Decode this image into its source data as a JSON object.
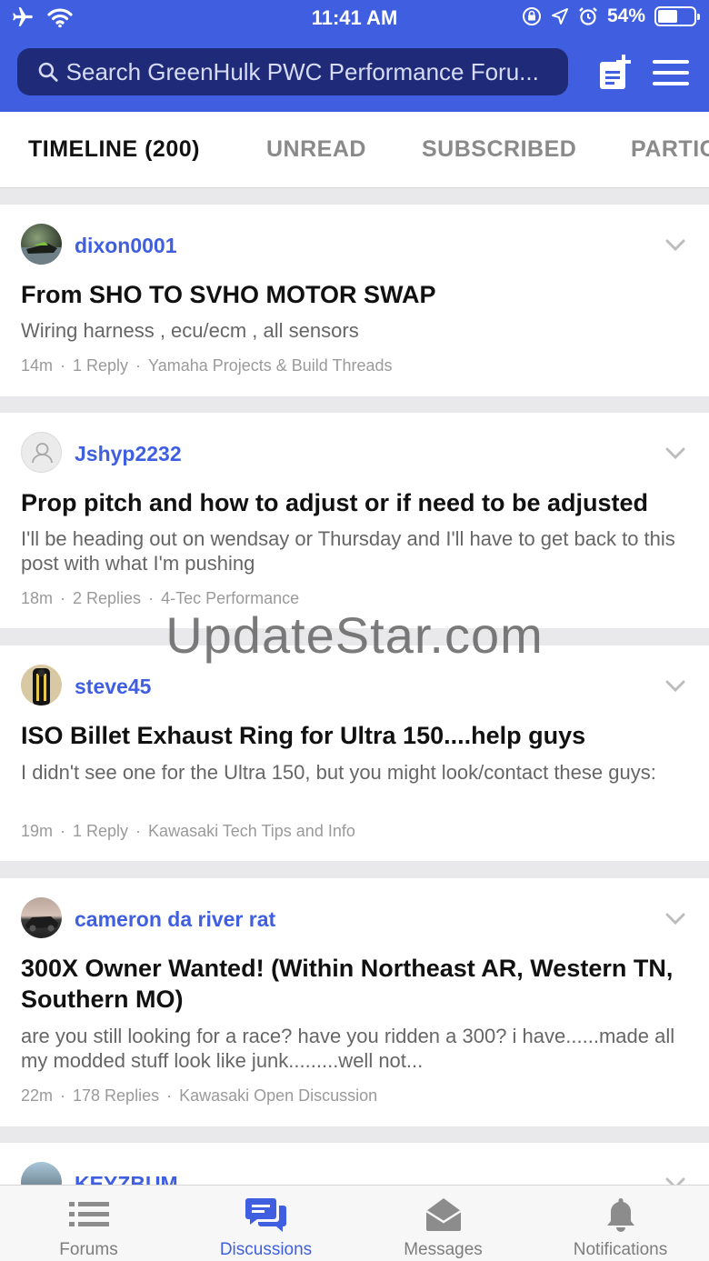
{
  "status_bar": {
    "time": "11:41 AM",
    "battery": "54%",
    "battery_level": 0.54
  },
  "search": {
    "placeholder": "Search GreenHulk PWC Performance Foru..."
  },
  "tabs": [
    {
      "label": "TIMELINE (200)",
      "active": true
    },
    {
      "label": "UNREAD",
      "active": false
    },
    {
      "label": "SUBSCRIBED",
      "active": false
    },
    {
      "label": "PARTICIPATED",
      "active": false
    }
  ],
  "posts": [
    {
      "username": "dixon0001",
      "title": "From SHO TO SVHO MOTOR SWAP",
      "snippet": "Wiring harness , ecu/ecm , all sensors",
      "time": "14m",
      "replies": "1 Reply",
      "forum": "Yamaha Projects & Build Threads"
    },
    {
      "username": "Jshyp2232",
      "title": "Prop pitch and how to adjust or if need to be adjusted",
      "snippet": "I'll be heading out on wendsay or Thursday and I'll have to get back to this post with what I'm pushing",
      "time": "18m",
      "replies": "2 Replies",
      "forum": "4-Tec Performance"
    },
    {
      "username": "steve45",
      "title": "ISO Billet Exhaust Ring for Ultra 150....help guys",
      "snippet": "I didn't see one for the Ultra 150, but you might look/contact these guys:",
      "time": "19m",
      "replies": "1 Reply",
      "forum": "Kawasaki Tech Tips and Info"
    },
    {
      "username": "cameron da river rat",
      "title": "300X Owner Wanted! (Within Northeast AR, Western TN, Southern MO)",
      "snippet": "are you still looking for a race? have you ridden a 300? i have......made all my modded stuff look like junk.........well not...",
      "time": "22m",
      "replies": "178 Replies",
      "forum": "Kawasaki Open Discussion"
    },
    {
      "username": "KEYZBUM"
    }
  ],
  "watermark": "UpdateStar.com",
  "bottom_nav": [
    {
      "label": "Forums",
      "icon": "list-icon",
      "active": false
    },
    {
      "label": "Discussions",
      "icon": "chat-bubbles-icon",
      "active": true
    },
    {
      "label": "Messages",
      "icon": "envelope-icon",
      "active": false
    },
    {
      "label": "Notifications",
      "icon": "bell-icon",
      "active": false
    }
  ],
  "colors": {
    "accent": "#3f5fe0",
    "search_bg": "#1f2a78"
  }
}
